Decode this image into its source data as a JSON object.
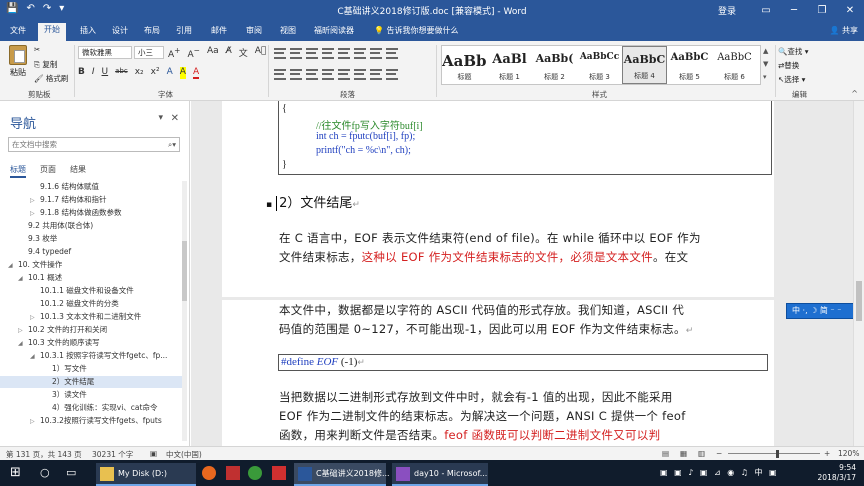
{
  "window": {
    "title": "C基础讲义2018修订版.doc [兼容模式] - Word",
    "login": "登录",
    "share": "共享"
  },
  "ribbon_tabs": [
    "文件",
    "开始",
    "插入",
    "设计",
    "布局",
    "引用",
    "邮件",
    "审阅",
    "视图",
    "福昕阅读器"
  ],
  "tell_me": "告诉我你想要做什么",
  "clipboard": {
    "paste": "粘贴",
    "cut": "✂",
    "copy": "复制",
    "format_painter": "格式刷",
    "label": "剪贴板"
  },
  "font": {
    "name": "微软雅黑",
    "size": "小三",
    "label": "字体",
    "format_buttons": [
      "B",
      "I",
      "U",
      "abc",
      "x₂",
      "x²",
      "A",
      "A",
      "A"
    ]
  },
  "paragraph": {
    "label": "段落"
  },
  "styles": {
    "label": "样式",
    "items": [
      {
        "sample": "AaBbC",
        "name": "标题"
      },
      {
        "sample": "AaBl",
        "name": "标题 1"
      },
      {
        "sample": "AaBb(",
        "name": "标题 2"
      },
      {
        "sample": "AaBbCc",
        "name": "标题 3"
      },
      {
        "sample": "AaBbC",
        "name": "标题 4"
      },
      {
        "sample": "AaBbC",
        "name": "标题 5"
      },
      {
        "sample": "AaBbC",
        "name": "标题 6"
      }
    ],
    "selected_index": 4
  },
  "editing": {
    "label": "编辑",
    "find": "查找",
    "replace": "替换",
    "select": "选择"
  },
  "nav": {
    "title": "导航",
    "search_placeholder": "在文档中搜索",
    "tabs": [
      "标题",
      "页面",
      "结果"
    ],
    "items": [
      {
        "label": "9.1.6 结构体赋值",
        "level": 4,
        "arrow": ""
      },
      {
        "label": "9.1.7 结构体和指针",
        "level": 4,
        "arrow": "▷"
      },
      {
        "label": "9.1.8 结构体做函数参数",
        "level": 4,
        "arrow": "▷"
      },
      {
        "label": "9.2 共用体(联合体)",
        "level": 3,
        "arrow": ""
      },
      {
        "label": "9.3 枚举",
        "level": 3,
        "arrow": ""
      },
      {
        "label": "9.4 typedef",
        "level": 3,
        "arrow": ""
      },
      {
        "label": "10. 文件操作",
        "level": 2,
        "arrow": "◢"
      },
      {
        "label": "10.1 概述",
        "level": 3,
        "arrow": "◢"
      },
      {
        "label": "10.1.1 磁盘文件和设备文件",
        "level": 4,
        "arrow": ""
      },
      {
        "label": "10.1.2 磁盘文件的分类",
        "level": 4,
        "arrow": ""
      },
      {
        "label": "10.1.3 文本文件和二进制文件",
        "level": 4,
        "arrow": "▷"
      },
      {
        "label": "10.2 文件的打开和关闭",
        "level": 3,
        "arrow": "▷"
      },
      {
        "label": "10.3 文件的顺序读写",
        "level": 3,
        "arrow": "◢"
      },
      {
        "label": "10.3.1 按照字符读写文件fgetc、fp...",
        "level": 4,
        "arrow": "◢"
      },
      {
        "label": "1）写文件",
        "level": 5,
        "arrow": ""
      },
      {
        "label": "2）文件结尾",
        "level": 5,
        "arrow": ""
      },
      {
        "label": "3）读文件",
        "level": 5,
        "arrow": ""
      },
      {
        "label": "4）强化训练：实现vi、cat命令",
        "level": 5,
        "arrow": ""
      },
      {
        "label": "10.3.2按照行读写文件fgets、fputs",
        "level": 4,
        "arrow": "▷"
      }
    ],
    "selected_index": 15
  },
  "document": {
    "code_lines": [
      {
        "text": "{",
        "color": "dark"
      },
      {
        "text": "//往文件fp写入字符buf[i]",
        "color": "green"
      },
      {
        "text": "int ch = fputc(buf[i], fp);",
        "color": "dark"
      },
      {
        "text": "printf(\"ch = %c\\n\", ch);",
        "color": "dark"
      },
      {
        "text": "}",
        "color": "dark"
      }
    ],
    "heading": "2）文件结尾",
    "para1_line1": "在 C 语言中，EOF 表示文件结束符(end of file)。在 while 循环中以 EOF 作为",
    "para1_line2_a": "文件结束标志，",
    "para1_line2_red": "这种以 EOF 作为文件结束标志的文件，必须是文本文件",
    "para1_line2_b": "。在文",
    "para2_line1": "本文件中，数据都是以字符的 ASCII 代码值的形式存放。我们知道，ASCII 代",
    "para2_line2": "码值的范围是 0~127，不可能出现-1，因此可以用 EOF 作为文件结束标志。",
    "define_prefix": "#define ",
    "define_macro": "EOF",
    "define_value": "   (-1)",
    "para3_line1": "当把数据以二进制形式存放到文件中时，就会有-1 值的出现，因此不能采用",
    "para3_line2": "EOF 作为二进制文件的结束标志。为解决这一个问题，ANSI C 提供一个 feof",
    "para3_line3_a": "函数，用来判断文件是否结束。",
    "para3_line3_red": "feof 函数既可以判断二进制文件又可以判"
  },
  "ime": "中 ·,  ☽ 简 ⁻ ⁻",
  "status": {
    "page": "第 131 页，共 143 页",
    "words": "30231 个字",
    "lang": "中文(中国)",
    "zoom": "120%"
  },
  "taskbar": {
    "apps": [
      {
        "label": "My Disk (D:)"
      },
      {
        "label": "C基础讲义2018修..."
      },
      {
        "label": "day10 - Microsof..."
      }
    ],
    "time": "9:54",
    "date": "2018/3/17"
  },
  "colors": {
    "word_blue": "#2b579a",
    "green_comment": "#2c8a2c",
    "red_emphasis": "#d42020",
    "taskbar": "#101c2c"
  }
}
